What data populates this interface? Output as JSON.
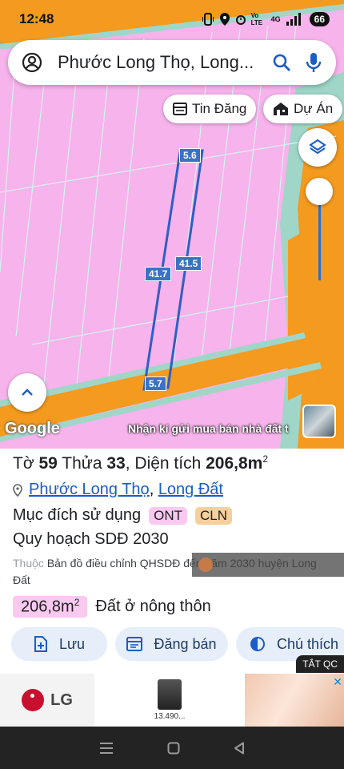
{
  "status": {
    "time": "12:48",
    "network": "4G",
    "volte": "Vo LTE",
    "battery": "66"
  },
  "search": {
    "query": "Phước Long Thọ, Long..."
  },
  "chips": {
    "news": "Tin Đăng",
    "project": "Dự Án"
  },
  "map": {
    "labels": {
      "top": "5.6",
      "left": "41.7",
      "right": "41.5",
      "bottom": "5.7"
    },
    "logo": "Google",
    "ad_overlay": "Nhận kí gửi mua bán nhà đất t"
  },
  "parcel": {
    "sheet_label": "Tờ",
    "sheet": "59",
    "lot_label": "Thửa",
    "lot": "33",
    "area_label": "Diện tích",
    "area": "206,8m",
    "area_sup": "2",
    "ward": "Phước Long Thọ",
    "district": "Long Đất",
    "purpose_label": "Mục đích sử dụng",
    "tag_ont": "ONT",
    "tag_cln": "CLN",
    "plan_title": "Quy hoạch SDĐ 2030",
    "belong_prefix": "Thuộc",
    "belong_text": "Bản đồ điều chỉnh QHSDĐ đến năm 2030 huyện Long Đất",
    "area_badge": "206,8m",
    "area_badge_sup": "2",
    "land_type": "Đất ở nông thôn"
  },
  "actions": {
    "save": "Lưu",
    "post": "Đăng bán",
    "note": "Chú thích"
  },
  "ads": {
    "close_label": "TẮT QC",
    "brand": "LG",
    "price": "13.490..."
  },
  "colors": {
    "accent": "#1a5cc8",
    "land_pink": "#f7b3ec",
    "road_orange": "#f39a1f",
    "river_teal": "#9fd6c8"
  }
}
